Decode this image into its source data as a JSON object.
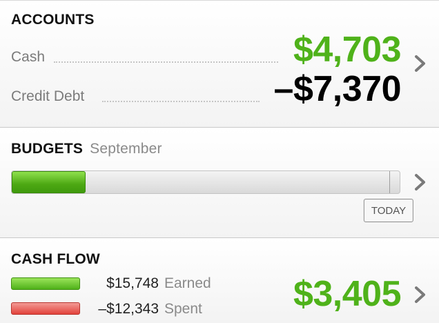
{
  "accounts": {
    "title": "ACCOUNTS",
    "cash_label": "Cash",
    "cash_value": "$4,703",
    "credit_label": "Credit Debt",
    "credit_value": "–$7,370"
  },
  "budgets": {
    "title": "BUDGETS",
    "month": "September",
    "progress_fraction": 0.19,
    "today_fraction": 0.97,
    "today_label": "TODAY"
  },
  "cashflow": {
    "title": "CASH FLOW",
    "earned_amount": "$15,748",
    "earned_label": "Earned",
    "spent_amount": "–$12,343",
    "spent_label": "Spent",
    "net_value": "$3,405"
  },
  "icons": {
    "chevron": "chevron-right-icon"
  },
  "colors": {
    "positive": "#4fb21a",
    "negative": "#e2433c",
    "chevron": "#7a7a7a"
  }
}
